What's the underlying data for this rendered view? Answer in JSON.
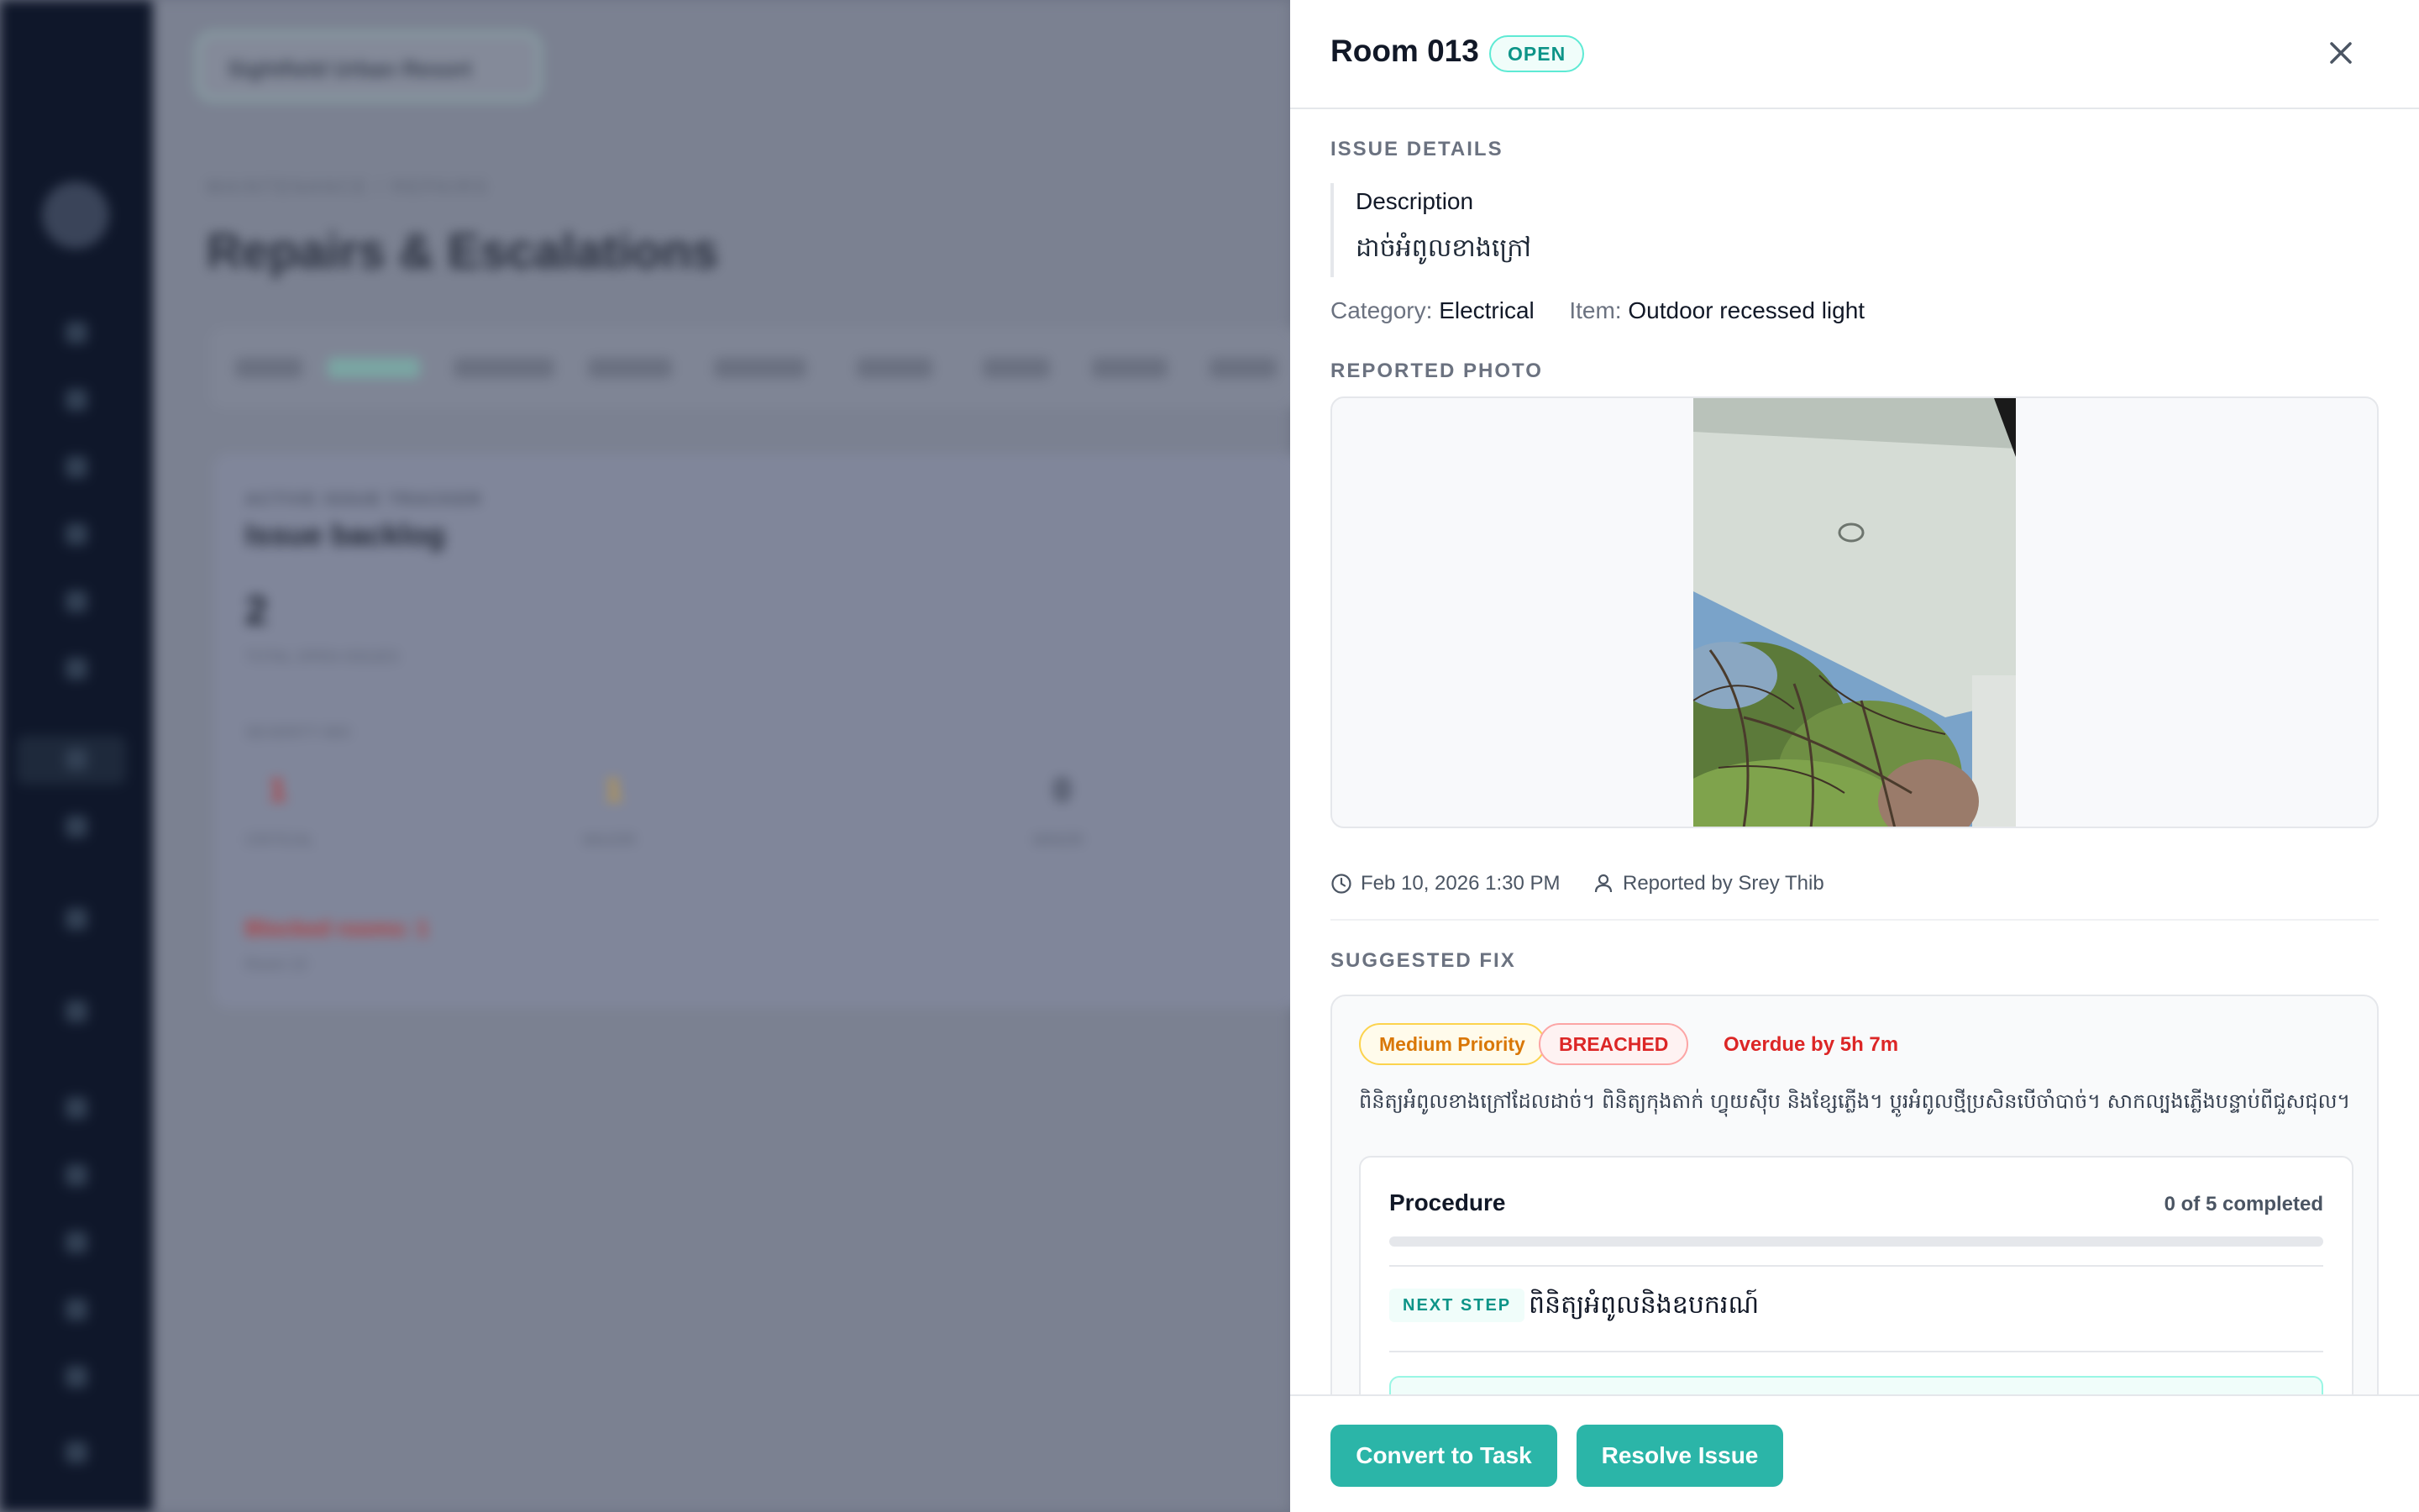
{
  "background": {
    "property_selector": "Sightfield Urban Resort",
    "breadcrumb": "MAINTENANCE / REPAIRS",
    "page_title": "Repairs & Escalations",
    "tabs": [
      "Status",
      "Open",
      "Resolved",
      "Severity",
      "Category",
      "Sort",
      "Group",
      "Assign",
      "More"
    ],
    "card_eyebrow": "ACTIVE ISSUE TRACKER",
    "card_title": "Issue backlog",
    "total_open": "2",
    "total_label": "TOTAL OPEN ISSUES",
    "severity_label": "SEVERITY MIX",
    "severity": [
      {
        "value": "1",
        "label": "CRITICAL",
        "color": "#b43b3b"
      },
      {
        "value": "1",
        "label": "MAJOR",
        "color": "#c79a3a"
      },
      {
        "value": "0",
        "label": "MINOR",
        "color": "#3b4252"
      }
    ],
    "blocked": "Blocked rooms: 1",
    "blocked_sub": "Room 13"
  },
  "panel": {
    "title": "Room 013",
    "status": "OPEN",
    "issue_details_label": "ISSUE DETAILS",
    "description_label": "Description",
    "description": "ដាច់អំពូលខាងក្រៅ",
    "category_key": "Category:",
    "category_value": "Electrical",
    "item_key": "Item:",
    "item_value": "Outdoor recessed light",
    "photo_label": "REPORTED PHOTO",
    "reported_at": "Feb 10, 2026 1:30 PM",
    "reported_by": "Reported by Srey Thib",
    "suggested_fix_label": "SUGGESTED FIX",
    "priority": "Medium Priority",
    "sla_status": "BREACHED",
    "overdue": "Overdue by 5h 7m",
    "fix_text": "ពិនិត្យអំពូលខាងក្រៅដែលដាច់។ ពិនិត្យកុងតាក់ ហ្វុយស៊ីប និងខ្សែភ្លើង។ ប្តូរអំពូលថ្មីប្រសិនបើចាំបាច់។ សាកល្បងភ្លើងបន្ទាប់ពីជួសជុល។",
    "procedure": {
      "title": "Procedure",
      "progress_text": "0 of 5 completed",
      "progress": 0,
      "next_step_label": "NEXT STEP",
      "next_step": "ពិនិត្យអំពូលនិងឧបករណ៍"
    },
    "buttons": {
      "convert": "Convert to Task",
      "resolve": "Resolve Issue"
    }
  },
  "colors": {
    "accent": "#2bb5a8",
    "danger": "#dc2626",
    "warning": "#d97706",
    "sidebar": "#0f172a"
  }
}
